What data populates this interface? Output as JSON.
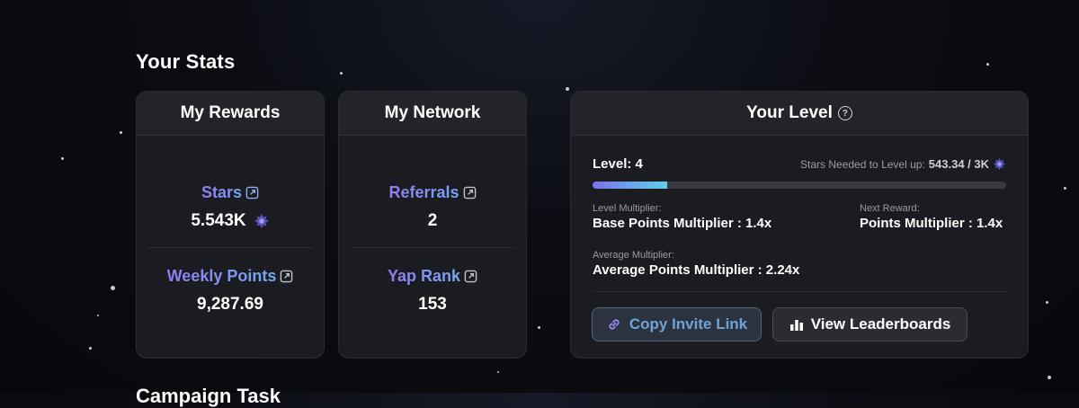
{
  "section": {
    "title": "Your Stats",
    "next_section_title": "Campaign Task"
  },
  "rewards": {
    "title": "My Rewards",
    "stars_label": "Stars",
    "stars_value": "5.543K",
    "weekly_label": "Weekly Points",
    "weekly_value": "9,287.69"
  },
  "network": {
    "title": "My Network",
    "referrals_label": "Referrals",
    "referrals_value": "2",
    "yap_label": "Yap Rank",
    "yap_value": "153"
  },
  "level": {
    "title": "Your Level",
    "level_text": "Level: 4",
    "needed_label": "Stars Needed to Level up:",
    "needed_value": "543.34 / 3K",
    "progress_fraction": 0.18,
    "level_multiplier_caption": "Level Multiplier:",
    "level_multiplier_value": "Base Points Multiplier : 1.4x",
    "next_reward_caption": "Next Reward:",
    "next_reward_value": "Points Multiplier : 1.4x",
    "avg_caption": "Average Multiplier:",
    "avg_value": "Average Points Multiplier : 2.24x",
    "copy_button": "Copy Invite Link",
    "leaderboard_button": "View Leaderboards"
  },
  "icons": {
    "external": "external-link-icon",
    "star_badge": "star-badge-icon",
    "info": "info-icon",
    "link": "link-icon",
    "chart": "bar-chart-icon"
  },
  "colors": {
    "accent_purple": "#8f7cf0",
    "accent_blue": "#6fb3f2",
    "card_bg": "#1b1c21"
  }
}
